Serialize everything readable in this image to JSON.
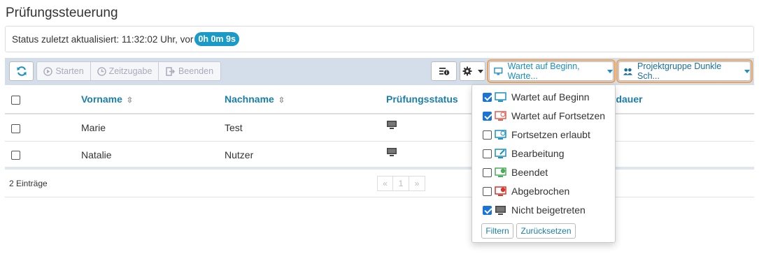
{
  "page": {
    "title": "Prüfungssteuerung"
  },
  "status": {
    "text": "Status zuletzt aktualisiert: 11:32:02 Uhr, vor",
    "badge": "0h 0m 9s"
  },
  "toolbar": {
    "start_label": "Starten",
    "extra_time_label": "Zeitzugabe",
    "end_label": "Beenden",
    "status_filter_label": "Wartet auf Beginn, Warte...",
    "group_filter_label": "Projektgruppe Dunkle Sch...",
    "colors": {
      "toolbar_bg": "#d3deea",
      "accent": "#1a8fc0",
      "highlight": "#f0a155"
    }
  },
  "table": {
    "headers": {
      "firstname": "Vorname",
      "lastname": "Nachname",
      "status": "Prüfungsstatus",
      "duration_partial": "stdauer"
    },
    "rows": [
      {
        "firstname": "Marie",
        "lastname": "Test",
        "status_icon": "monitor-icon"
      },
      {
        "firstname": "Natalie",
        "lastname": "Nutzer",
        "status_icon": "monitor-icon"
      }
    ]
  },
  "footer": {
    "count": "2 Einträge",
    "pager": {
      "prev": "«",
      "page": "1",
      "next": "»"
    }
  },
  "dropdown": {
    "items": [
      {
        "label": "Wartet auf Beginn",
        "checked": true,
        "icon": "monitor-waiting-icon"
      },
      {
        "label": "Wartet auf Fortsetzen",
        "checked": true,
        "icon": "monitor-resume-waiting-icon"
      },
      {
        "label": "Fortsetzen erlaubt",
        "checked": false,
        "icon": "monitor-resume-allowed-icon"
      },
      {
        "label": "Bearbeitung",
        "checked": false,
        "icon": "monitor-editing-icon"
      },
      {
        "label": "Beendet",
        "checked": false,
        "icon": "monitor-finished-icon"
      },
      {
        "label": "Abgebrochen",
        "checked": false,
        "icon": "monitor-aborted-icon"
      },
      {
        "label": "Nicht beigetreten",
        "checked": true,
        "icon": "monitor-not-joined-icon"
      }
    ],
    "filter_button": "Filtern",
    "reset_button": "Zurücksetzen"
  }
}
